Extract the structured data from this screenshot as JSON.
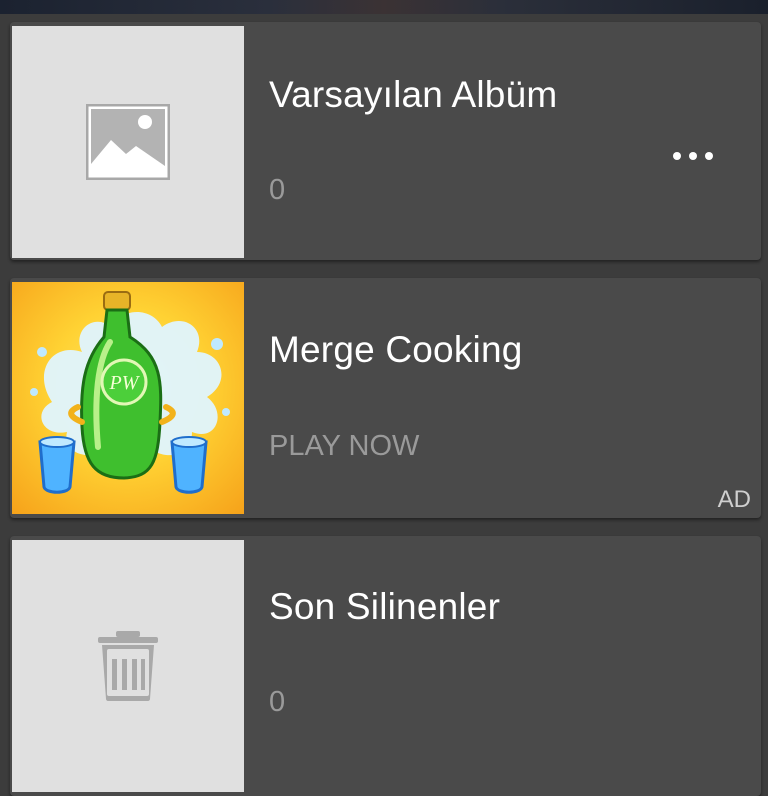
{
  "albums": [
    {
      "title": "Varsayılan Albüm",
      "count": "0",
      "icon": "image-placeholder-icon",
      "has_menu": true
    },
    {
      "title": "Merge Cooking",
      "subtitle": "PLAY NOW",
      "badge": "AD",
      "icon": "merge-cooking-app-icon",
      "bottle_label": "PW"
    },
    {
      "title": "Son Silinenler",
      "count": "0",
      "icon": "trash-icon"
    }
  ],
  "colors": {
    "background": "#3c3c3c",
    "card": "#4a4a4a",
    "thumb_placeholder": "#e0e0e0",
    "text_primary": "#ffffff",
    "text_secondary": "#9a9a9a"
  }
}
